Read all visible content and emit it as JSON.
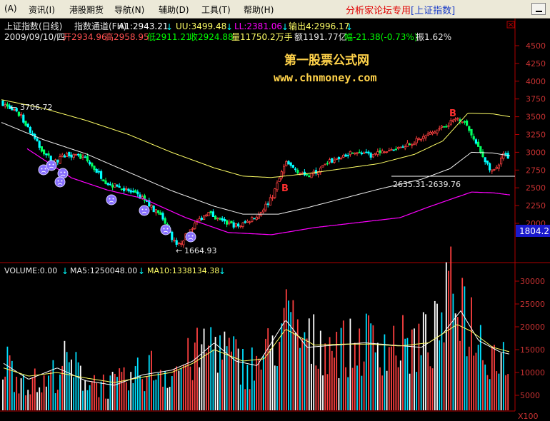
{
  "menu": {
    "items": [
      "(A)",
      "资讯(I)",
      "港股期货",
      "导航(N)",
      "辅助(D)",
      "工具(T)",
      "帮助(H)"
    ]
  },
  "app_title": {
    "prefix": "分析家论坛专用",
    "index": "[上证指数]"
  },
  "main_chart": {
    "header": {
      "name": "上证指数(日线)",
      "indicator": "指数通道(FH)",
      "a1": "A1:2943.21",
      "uu": "UU:3499.48",
      "ll": "LL:2381.06",
      "out4": "输出4:2996.17"
    },
    "quote": {
      "date": "2009/09/10/四",
      "open": "开2934.96",
      "high": "高2958.95",
      "low": "低2911.21",
      "close": "收2924.88",
      "volume": "量11750.2万手",
      "amount": "额1191.77亿",
      "change": "幅-21.38(-0.73%)",
      "amplitude": "振1.62%"
    },
    "watermark": {
      "line1": "第一股票公式网",
      "line2": "www.chnmoney.com"
    },
    "y_axis_labels": [
      "4500",
      "4250",
      "4000",
      "3750",
      "3500",
      "3250",
      "3000",
      "2750",
      "2500",
      "2250",
      "2000"
    ],
    "current_price_label": "1804.2",
    "annotations": {
      "high": "3706.72",
      "low": "1664.93",
      "range": "2635.31-2639.76",
      "signal_b": "B"
    },
    "colors": {
      "up": "#ff4040",
      "down": "#00ffff",
      "uu": "#ffff66",
      "mid": "#ffffff",
      "ll": "#ff00ff",
      "axis": "#b00000"
    }
  },
  "volume_chart": {
    "header": {
      "volume": "VOLUME:0.00",
      "ma5": "MA5:1250048.00",
      "ma10": "MA10:1338134.38"
    },
    "y_axis_labels": [
      "30000",
      "25000",
      "20000",
      "15000",
      "10000",
      "5000"
    ],
    "unit": "X100"
  },
  "chart_data": {
    "type": "candlestick",
    "x_range": [
      "",
      "2009/09/10"
    ],
    "y_range": [
      1600,
      4700
    ],
    "uu": [
      [
        2,
        3740
      ],
      [
        60,
        3620
      ],
      [
        120,
        3450
      ],
      [
        180,
        3250
      ],
      [
        240,
        3000
      ],
      [
        300,
        2780
      ],
      [
        340,
        2665
      ],
      [
        380,
        2645
      ],
      [
        430,
        2700
      ],
      [
        480,
        2770
      ],
      [
        530,
        2840
      ],
      [
        580,
        2970
      ],
      [
        620,
        3160
      ],
      [
        655,
        3550
      ],
      [
        690,
        3540
      ],
      [
        714,
        3500
      ]
    ],
    "ll": [
      [
        38,
        3050
      ],
      [
        100,
        2640
      ],
      [
        150,
        2470
      ],
      [
        200,
        2350
      ],
      [
        260,
        2080
      ],
      [
        320,
        1870
      ],
      [
        380,
        1840
      ],
      [
        440,
        1940
      ],
      [
        500,
        2010
      ],
      [
        560,
        2080
      ],
      [
        600,
        2230
      ],
      [
        640,
        2370
      ],
      [
        660,
        2440
      ],
      [
        690,
        2430
      ],
      [
        714,
        2400
      ]
    ],
    "mid": [
      [
        2,
        3420
      ],
      [
        60,
        3180
      ],
      [
        120,
        2980
      ],
      [
        180,
        2720
      ],
      [
        240,
        2460
      ],
      [
        300,
        2240
      ],
      [
        340,
        2130
      ],
      [
        390,
        2130
      ],
      [
        430,
        2220
      ],
      [
        480,
        2350
      ],
      [
        530,
        2480
      ],
      [
        590,
        2620
      ],
      [
        630,
        2770
      ],
      [
        660,
        3000
      ],
      [
        690,
        2990
      ],
      [
        714,
        2950
      ]
    ],
    "price": [
      [
        2,
        3706
      ],
      [
        30,
        3500
      ],
      [
        55,
        3080
      ],
      [
        75,
        2850
      ],
      [
        95,
        2980
      ],
      [
        120,
        2900
      ],
      [
        150,
        2570
      ],
      [
        180,
        2450
      ],
      [
        200,
        2350
      ],
      [
        225,
        2100
      ],
      [
        248,
        1665
      ],
      [
        270,
        1960
      ],
      [
        290,
        2160
      ],
      [
        310,
        2020
      ],
      [
        335,
        1960
      ],
      [
        360,
        2100
      ],
      [
        380,
        2350
      ],
      [
        400,
        2850
      ],
      [
        430,
        2650
      ],
      [
        460,
        2860
      ],
      [
        490,
        3000
      ],
      [
        520,
        2950
      ],
      [
        550,
        3050
      ],
      [
        580,
        3150
      ],
      [
        610,
        3300
      ],
      [
        640,
        3480
      ],
      [
        648,
        3460
      ],
      [
        670,
        3050
      ],
      [
        690,
        2700
      ],
      [
        705,
        2970
      ],
      [
        714,
        2924
      ]
    ],
    "volume": [
      [
        5,
        12500
      ],
      [
        30,
        9000
      ],
      [
        60,
        7000
      ],
      [
        90,
        12000
      ],
      [
        120,
        9000
      ],
      [
        150,
        7000
      ],
      [
        180,
        8000
      ],
      [
        210,
        11000
      ],
      [
        240,
        10000
      ],
      [
        270,
        13000
      ],
      [
        300,
        17000
      ],
      [
        320,
        14000
      ],
      [
        345,
        11000
      ],
      [
        370,
        13000
      ],
      [
        400,
        21000
      ],
      [
        430,
        16000
      ],
      [
        460,
        16500
      ],
      [
        490,
        15000
      ],
      [
        520,
        17000
      ],
      [
        550,
        16000
      ],
      [
        580,
        15500
      ],
      [
        610,
        18000
      ],
      [
        640,
        30000
      ],
      [
        655,
        22000
      ],
      [
        680,
        15000
      ],
      [
        700,
        14000
      ],
      [
        714,
        13000
      ]
    ],
    "ma5": [
      [
        5,
        12000
      ],
      [
        40,
        8500
      ],
      [
        80,
        11000
      ],
      [
        120,
        8200
      ],
      [
        160,
        7200
      ],
      [
        200,
        9500
      ],
      [
        240,
        10500
      ],
      [
        270,
        12500
      ],
      [
        300,
        16500
      ],
      [
        330,
        12500
      ],
      [
        360,
        11500
      ],
      [
        400,
        21500
      ],
      [
        430,
        15500
      ],
      [
        470,
        16000
      ],
      [
        510,
        16500
      ],
      [
        550,
        16000
      ],
      [
        590,
        15500
      ],
      [
        620,
        18500
      ],
      [
        645,
        23500
      ],
      [
        670,
        17000
      ],
      [
        700,
        14500
      ],
      [
        714,
        14000
      ]
    ],
    "ma10": [
      [
        5,
        11000
      ],
      [
        40,
        9200
      ],
      [
        80,
        10000
      ],
      [
        120,
        8800
      ],
      [
        160,
        7800
      ],
      [
        200,
        9000
      ],
      [
        240,
        10000
      ],
      [
        270,
        12000
      ],
      [
        300,
        15000
      ],
      [
        340,
        12500
      ],
      [
        370,
        13000
      ],
      [
        400,
        19500
      ],
      [
        440,
        16000
      ],
      [
        480,
        16200
      ],
      [
        520,
        16200
      ],
      [
        560,
        15800
      ],
      [
        600,
        16500
      ],
      [
        640,
        20500
      ],
      [
        660,
        19000
      ],
      [
        690,
        15500
      ],
      [
        714,
        14500
      ]
    ]
  }
}
